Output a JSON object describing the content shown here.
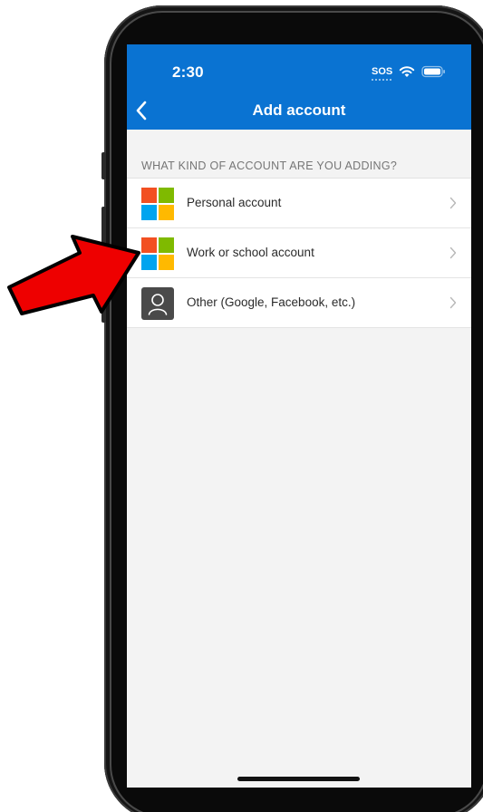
{
  "status_bar": {
    "time": "2:30",
    "sos": "SOS",
    "wifi_icon": "wifi-icon",
    "battery_icon": "battery-icon"
  },
  "nav": {
    "back_icon": "chevron-left-icon",
    "title": "Add account"
  },
  "section": {
    "header": "WHAT KIND OF ACCOUNT ARE YOU ADDING?"
  },
  "accounts": [
    {
      "label": "Personal account",
      "icon": "microsoft-logo-icon"
    },
    {
      "label": "Work or school account",
      "icon": "microsoft-logo-icon"
    },
    {
      "label": "Other (Google, Facebook, etc.)",
      "icon": "person-icon"
    }
  ],
  "annotation": {
    "icon": "red-arrow-icon",
    "color": "#ee0000"
  },
  "colors": {
    "app_bar": "#0a73d2",
    "background": "#f3f3f3",
    "ms_red": "#f25022",
    "ms_green": "#7fba00",
    "ms_blue": "#00a4ef",
    "ms_yellow": "#ffb900"
  }
}
